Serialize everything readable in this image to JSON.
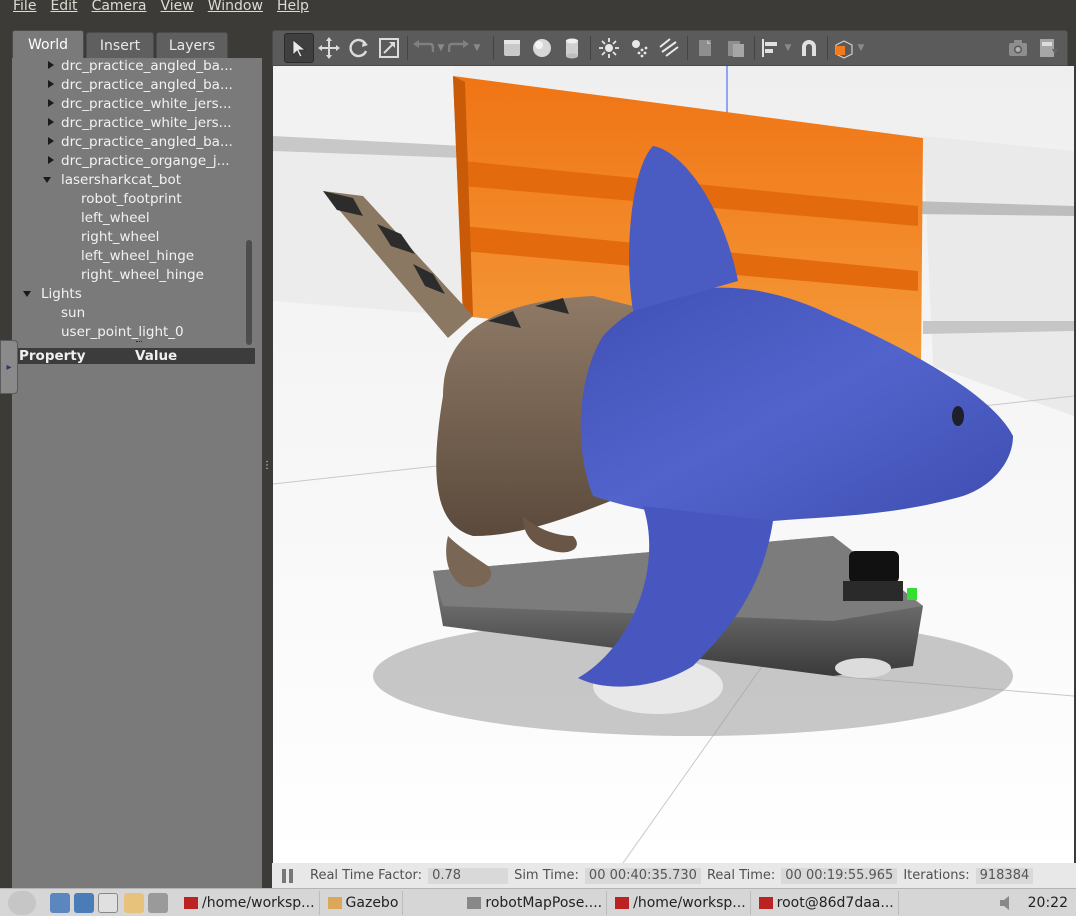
{
  "menubar": {
    "file": "File",
    "edit": "Edit",
    "camera": "Camera",
    "view": "View",
    "window": "Window",
    "help": "Help"
  },
  "left_panel": {
    "tabs": {
      "world": "World",
      "insert": "Insert",
      "layers": "Layers"
    },
    "tree": {
      "items": [
        "drc_practice_angled_ba...",
        "drc_practice_angled_ba...",
        "drc_practice_white_jers...",
        "drc_practice_white_jers...",
        "drc_practice_angled_ba...",
        "drc_practice_organge_j..."
      ],
      "robot": "lasersharkcat_bot",
      "links": [
        "robot_footprint",
        "left_wheel",
        "right_wheel",
        "left_wheel_hinge",
        "right_wheel_hinge"
      ],
      "lights": "Lights",
      "light_items": [
        "sun",
        "user_point_light_0"
      ]
    },
    "properties": {
      "property": "Property",
      "value": "Value"
    }
  },
  "statusbar": {
    "rtf_label": "Real Time Factor:",
    "rtf_value": "0.78",
    "sim_label": "Sim Time:",
    "sim_value": "00 00:40:35.730",
    "real_label": "Real Time:",
    "real_value": "00 00:19:55.965",
    "iter_label": "Iterations:",
    "iter_value": "918384"
  },
  "taskbar": {
    "tasks": [
      "/home/worksp...",
      "Gazebo",
      "robotMapPose....",
      "/home/worksp...",
      "root@86d7daa..."
    ],
    "clock": "20:22"
  },
  "colors": {
    "accent_orange": "#f07a1c",
    "shark_blue": "#4a5cc4",
    "panel_gray": "#7a7a7a",
    "dark_bg": "#3c3b37"
  }
}
